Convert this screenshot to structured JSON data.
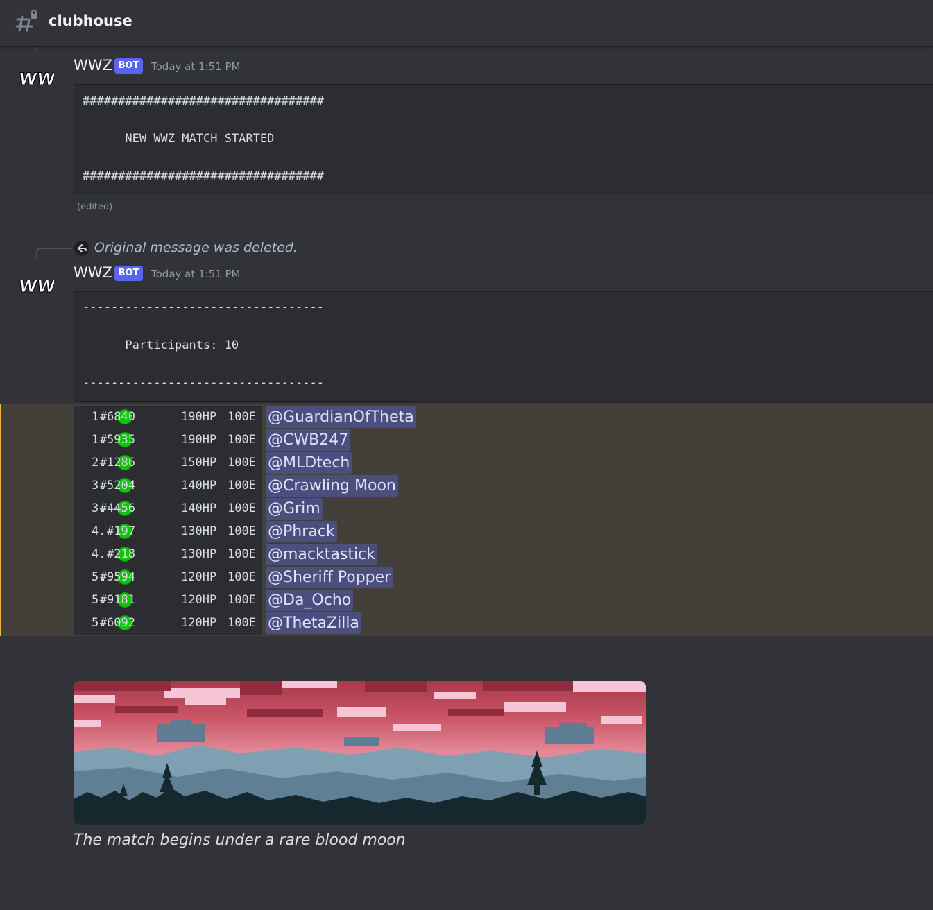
{
  "channel": {
    "name": "clubhouse",
    "icon": "locked-hash-icon"
  },
  "messages": [
    {
      "author": "WWZ",
      "tag": "BOT",
      "timestamp": "Today at 1:51 PM",
      "avatar_text": "WWZ",
      "code_lines": [
        "##################################",
        "      NEW WWZ MATCH STARTED",
        "##################################"
      ],
      "edited": "(edited)"
    },
    {
      "reply_text": "Original message was deleted.",
      "author": "WWZ",
      "tag": "BOT",
      "timestamp": "Today at 1:51 PM",
      "avatar_text": "WWZ",
      "code_lines": [
        "----------------------------------",
        "      Participants: 10",
        "----------------------------------"
      ]
    }
  ],
  "leaderboard": [
    {
      "rank": "1.",
      "id": "#6840",
      "hp": "190HP",
      "energy": "100E",
      "mention": "@GuardianOfTheta"
    },
    {
      "rank": "1.",
      "id": "#5935",
      "hp": "190HP",
      "energy": "100E",
      "mention": "@CWB247"
    },
    {
      "rank": "2.",
      "id": "#1286",
      "hp": "150HP",
      "energy": "100E",
      "mention": "@MLDtech"
    },
    {
      "rank": "3.",
      "id": "#5204",
      "hp": "140HP",
      "energy": "100E",
      "mention": "@Crawling Moon"
    },
    {
      "rank": "3.",
      "id": "#4456",
      "hp": "140HP",
      "energy": "100E",
      "mention": "@Grim"
    },
    {
      "rank": "4.",
      "id": "#197",
      "hp": "130HP",
      "energy": "100E",
      "mention": "@Phrack"
    },
    {
      "rank": "4.",
      "id": "#218",
      "hp": "130HP",
      "energy": "100E",
      "mention": "@macktastick"
    },
    {
      "rank": "5.",
      "id": "#9594",
      "hp": "120HP",
      "energy": "100E",
      "mention": "@Sheriff Popper"
    },
    {
      "rank": "5.",
      "id": "#9181",
      "hp": "120HP",
      "energy": "100E",
      "mention": "@Da_Ocho"
    },
    {
      "rank": "5.",
      "id": "#6092",
      "hp": "120HP",
      "energy": "100E",
      "mention": "@ThetaZilla"
    }
  ],
  "status_color": "#12c20e",
  "image": {
    "kind": "pixel-art blood moon landscape with trees"
  },
  "caption": "The match begins under a rare blood moon",
  "colors": {
    "background": "#313338",
    "code_bg": "#2b2d31",
    "mention_bg": "#4b4f7d",
    "highlight_bg": "#433f39",
    "highlight_bar": "#f0b232",
    "bot_tag": "#5865f2"
  }
}
